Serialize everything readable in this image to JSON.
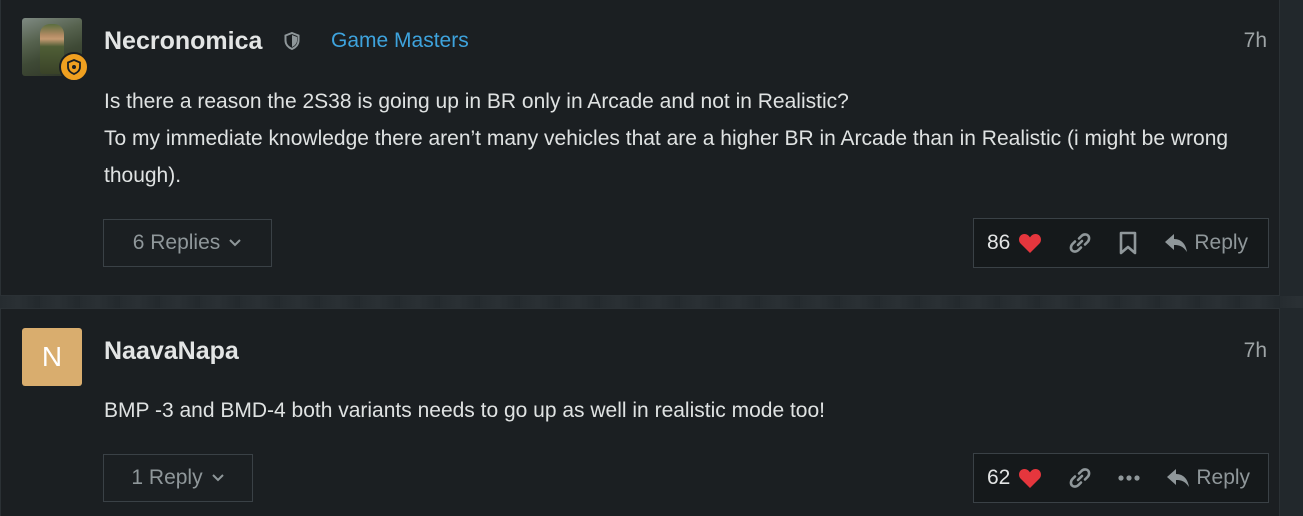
{
  "posts": [
    {
      "username": "Necronomica",
      "group": "Game Masters",
      "time": "7h",
      "body": [
        "Is there a reason the 2S38 is going up in BR only in Arcade and not in Realistic?",
        "To my immediate knowledge there aren’t many vehicles that are a higher BR in Arcade than in Realistic (i might be wrong though)."
      ],
      "replies_label": "6 Replies",
      "likes": "86",
      "reply_label": "Reply",
      "icons": [
        "shield-icon",
        "heart-icon",
        "link-icon",
        "bookmark-icon",
        "reply-icon",
        "chevron-down-icon"
      ]
    },
    {
      "username": "NaavaNapa",
      "avatar_letter": "N",
      "avatar_color": "#d9ad6e",
      "time": "7h",
      "body": [
        "BMP -3 and BMD-4 both variants needs to go up as well in realistic mode too!"
      ],
      "replies_label": "1 Reply",
      "likes": "62",
      "reply_label": "Reply",
      "icons": [
        "heart-icon",
        "link-icon",
        "more-icon",
        "reply-icon",
        "chevron-down-icon"
      ]
    }
  ],
  "colors": {
    "background": "#22282c",
    "post_bg": "#1b1f22",
    "group_link": "#3ea3dd",
    "heart": "#e5363d",
    "muted": "#8f979a"
  }
}
